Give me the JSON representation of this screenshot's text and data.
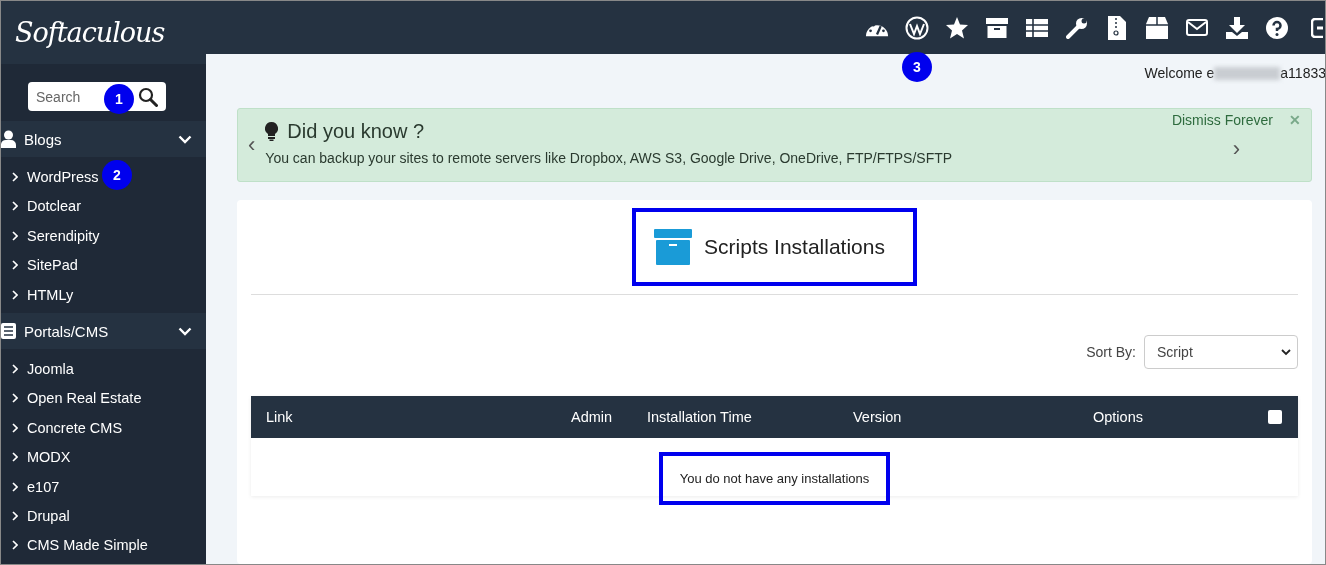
{
  "logo": "Softaculous",
  "search": {
    "placeholder": "Search",
    "callout": "1"
  },
  "toolbar": {
    "callout": "3"
  },
  "sidebar": {
    "groups": [
      {
        "label": "Blogs",
        "kind": "user",
        "expanded": true,
        "items": [
          {
            "label": "WordPress",
            "callout": "2"
          },
          {
            "label": "Dotclear"
          },
          {
            "label": "Serendipity"
          },
          {
            "label": "SitePad"
          },
          {
            "label": "HTMLy"
          }
        ]
      },
      {
        "label": "Portals/CMS",
        "kind": "list",
        "expanded": true,
        "items": [
          {
            "label": "Joomla"
          },
          {
            "label": "Open Real Estate"
          },
          {
            "label": "Concrete CMS"
          },
          {
            "label": "MODX"
          },
          {
            "label": "e107"
          },
          {
            "label": "Drupal"
          },
          {
            "label": "CMS Made Simple"
          }
        ]
      }
    ]
  },
  "welcome": {
    "prefix": "Welcome e",
    "suffix": "a11833"
  },
  "notice": {
    "title": "Did you know ?",
    "text": "You can backup your sites to remote servers like Dropbox, AWS S3, Google Drive, OneDrive, FTP/FTPS/SFTP",
    "dismiss": "Dismiss Forever",
    "close": "✕",
    "prev": "‹",
    "next": "›"
  },
  "panel": {
    "title": "Scripts Installations",
    "highlighted": true,
    "sort_label": "Sort By:",
    "sort_value": "Script",
    "columns": [
      "Link",
      "Admin",
      "Installation Time",
      "Version",
      "Options"
    ],
    "select_all_checked": false,
    "empty": {
      "text": "You do not have any installations",
      "highlighted": true
    }
  }
}
